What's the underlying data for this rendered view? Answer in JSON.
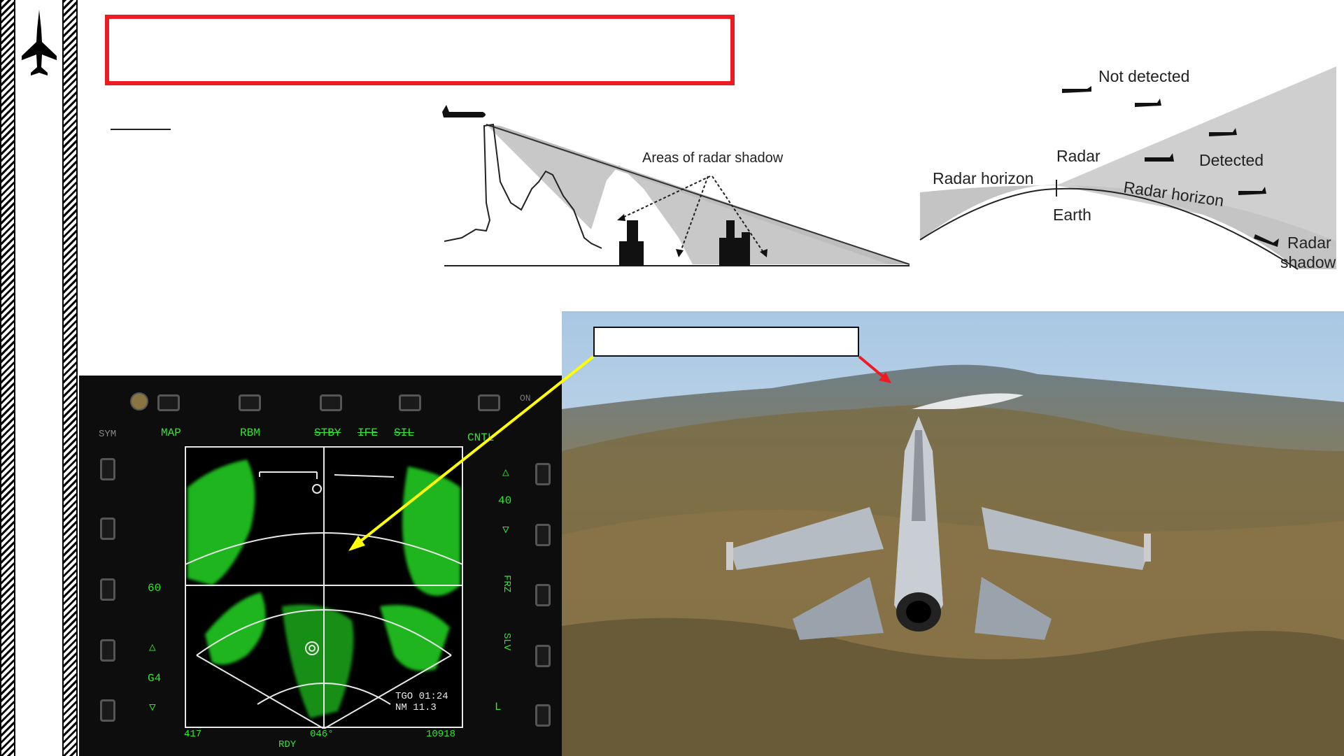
{
  "page": {
    "title_box_text": ""
  },
  "shadow_diagram": {
    "label": "Areas of radar shadow"
  },
  "horizon_diagram": {
    "not_detected": "Not detected",
    "radar": "Radar",
    "detected": "Detected",
    "radar_horizon_left": "Radar horizon",
    "radar_horizon_right": "Radar horizon",
    "earth": "Earth",
    "radar_shadow_line1": "Radar",
    "radar_shadow_line2": "shadow"
  },
  "mfd": {
    "top_labels": {
      "map": "MAP",
      "rbm": "RBM",
      "stby": "STBY",
      "ife": "IFE",
      "sil": "SIL",
      "cntl": "CNTL"
    },
    "sym": "SYM",
    "range": "40",
    "left_60": "60",
    "gain": "G4",
    "frz": "FRZ",
    "slv": "SLV",
    "l": "L",
    "on": "ON",
    "tgo": "TGO 01:24",
    "nm": "NM  11.3",
    "bottom_left": "417",
    "azimuth": "046°",
    "altitude": "10918",
    "rdy": "RDY"
  },
  "callout": {
    "text": ""
  },
  "colors": {
    "title_border": "#ee1b24",
    "radar_green": "#2ee82e",
    "yellow_arrow": "#ffff00",
    "red_arrow": "#ee1b24"
  },
  "icons": [
    "fighter-jet-icon"
  ]
}
